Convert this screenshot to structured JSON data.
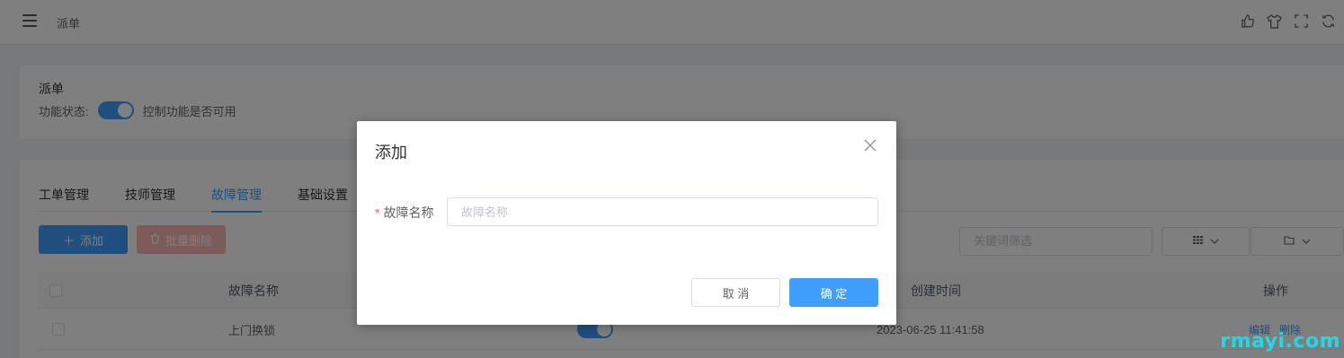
{
  "header": {
    "breadcrumb": "派单",
    "icons": [
      "thumb-icon",
      "shirt-icon",
      "fullscreen-icon",
      "refresh-icon"
    ]
  },
  "info": {
    "title": "派单",
    "status_label": "功能状态:",
    "status_enabled": true,
    "status_desc": "控制功能是否可用"
  },
  "tabs": [
    {
      "label": "工单管理",
      "active": false
    },
    {
      "label": "技师管理",
      "active": false
    },
    {
      "label": "故障管理",
      "active": true
    },
    {
      "label": "基础设置",
      "active": false
    }
  ],
  "toolbar": {
    "add_label": "添加",
    "batch_delete_label": "批量删除",
    "search_placeholder": "关键词筛选"
  },
  "table": {
    "headers": {
      "name": "故障名称",
      "created": "创建时间",
      "actions": "操作"
    },
    "rows": [
      {
        "name": "上门换锁",
        "enabled": true,
        "created": "2023-06-25 11:41:58",
        "edit": "编辑",
        "delete": "删除"
      }
    ]
  },
  "dialog": {
    "title": "添加",
    "field_label": "故障名称",
    "field_placeholder": "故障名称",
    "field_value": "",
    "cancel_label": "取 消",
    "confirm_label": "确 定"
  },
  "watermark": "rmayi.com",
  "colors": {
    "primary": "#409eff",
    "danger_light": "#fab6b6",
    "required": "#f56c6c"
  }
}
